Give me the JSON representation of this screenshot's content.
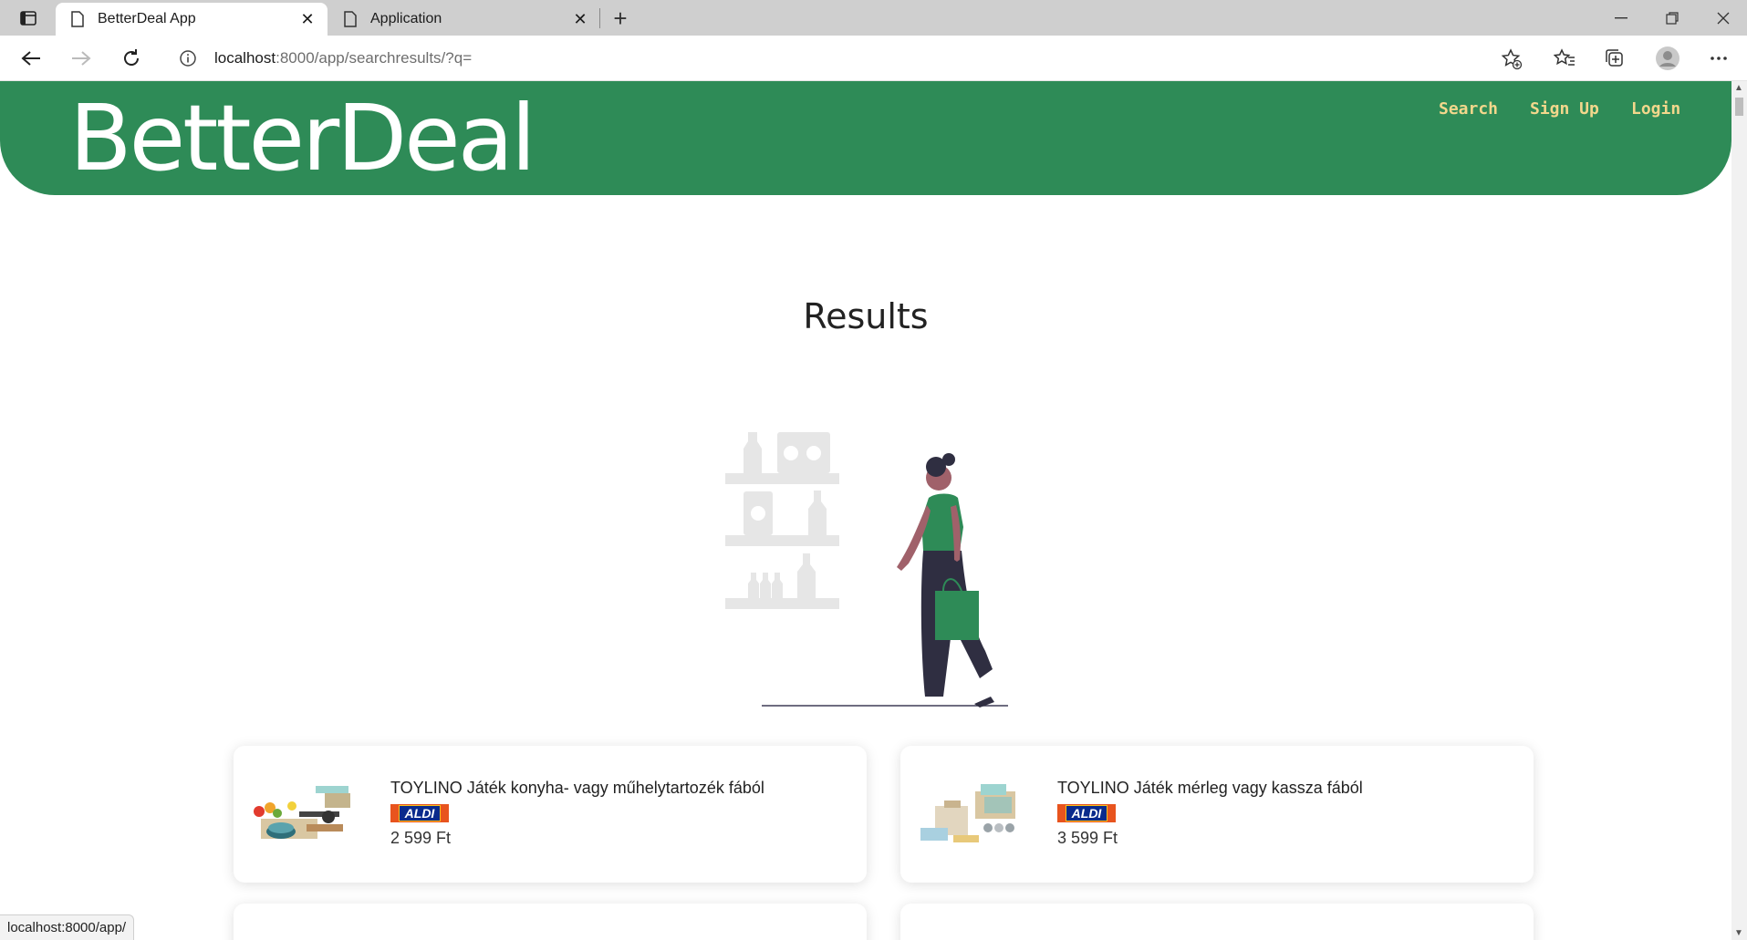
{
  "browser": {
    "tabs": [
      {
        "label": "BetterDeal App",
        "active": true
      },
      {
        "label": "Application",
        "active": false
      }
    ],
    "url_host": "localhost",
    "url_rest": ":8000/app/searchresults/?q=",
    "status_url": "localhost:8000/app/"
  },
  "header": {
    "brand": "BetterDeal",
    "nav": [
      "Search",
      "Sign Up",
      "Login"
    ]
  },
  "main": {
    "title": "Results",
    "products": [
      {
        "name": "TOYLINO Játék konyha- vagy műhelytartozék fából",
        "store": "ALDI",
        "price": "2 599 Ft"
      },
      {
        "name": "TOYLINO Játék mérleg vagy kassza fából",
        "store": "ALDI",
        "price": "3 599 Ft"
      }
    ]
  },
  "colors": {
    "brand_green": "#2e8b57",
    "nav_link": "#f2d78c",
    "aldi_orange": "#e8541e",
    "aldi_blue": "#0a2a8c"
  }
}
